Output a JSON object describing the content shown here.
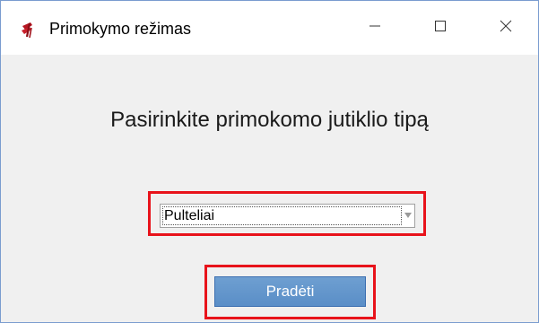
{
  "window": {
    "title": "Primokymo režimas",
    "app_icon": "red-paper-clip-icon",
    "caption_buttons": [
      "minimize-icon",
      "maximize-icon",
      "close-icon"
    ]
  },
  "main": {
    "heading": "Pasirinkite primokomo jutiklio tipą",
    "sensor_type_select": {
      "selected_value": "Pulteliai"
    },
    "start_button_label": "Pradėti"
  },
  "colors": {
    "highlight": "#e8131b",
    "button_blue": "#5a8ec7",
    "window_border": "#7a9ccf"
  }
}
